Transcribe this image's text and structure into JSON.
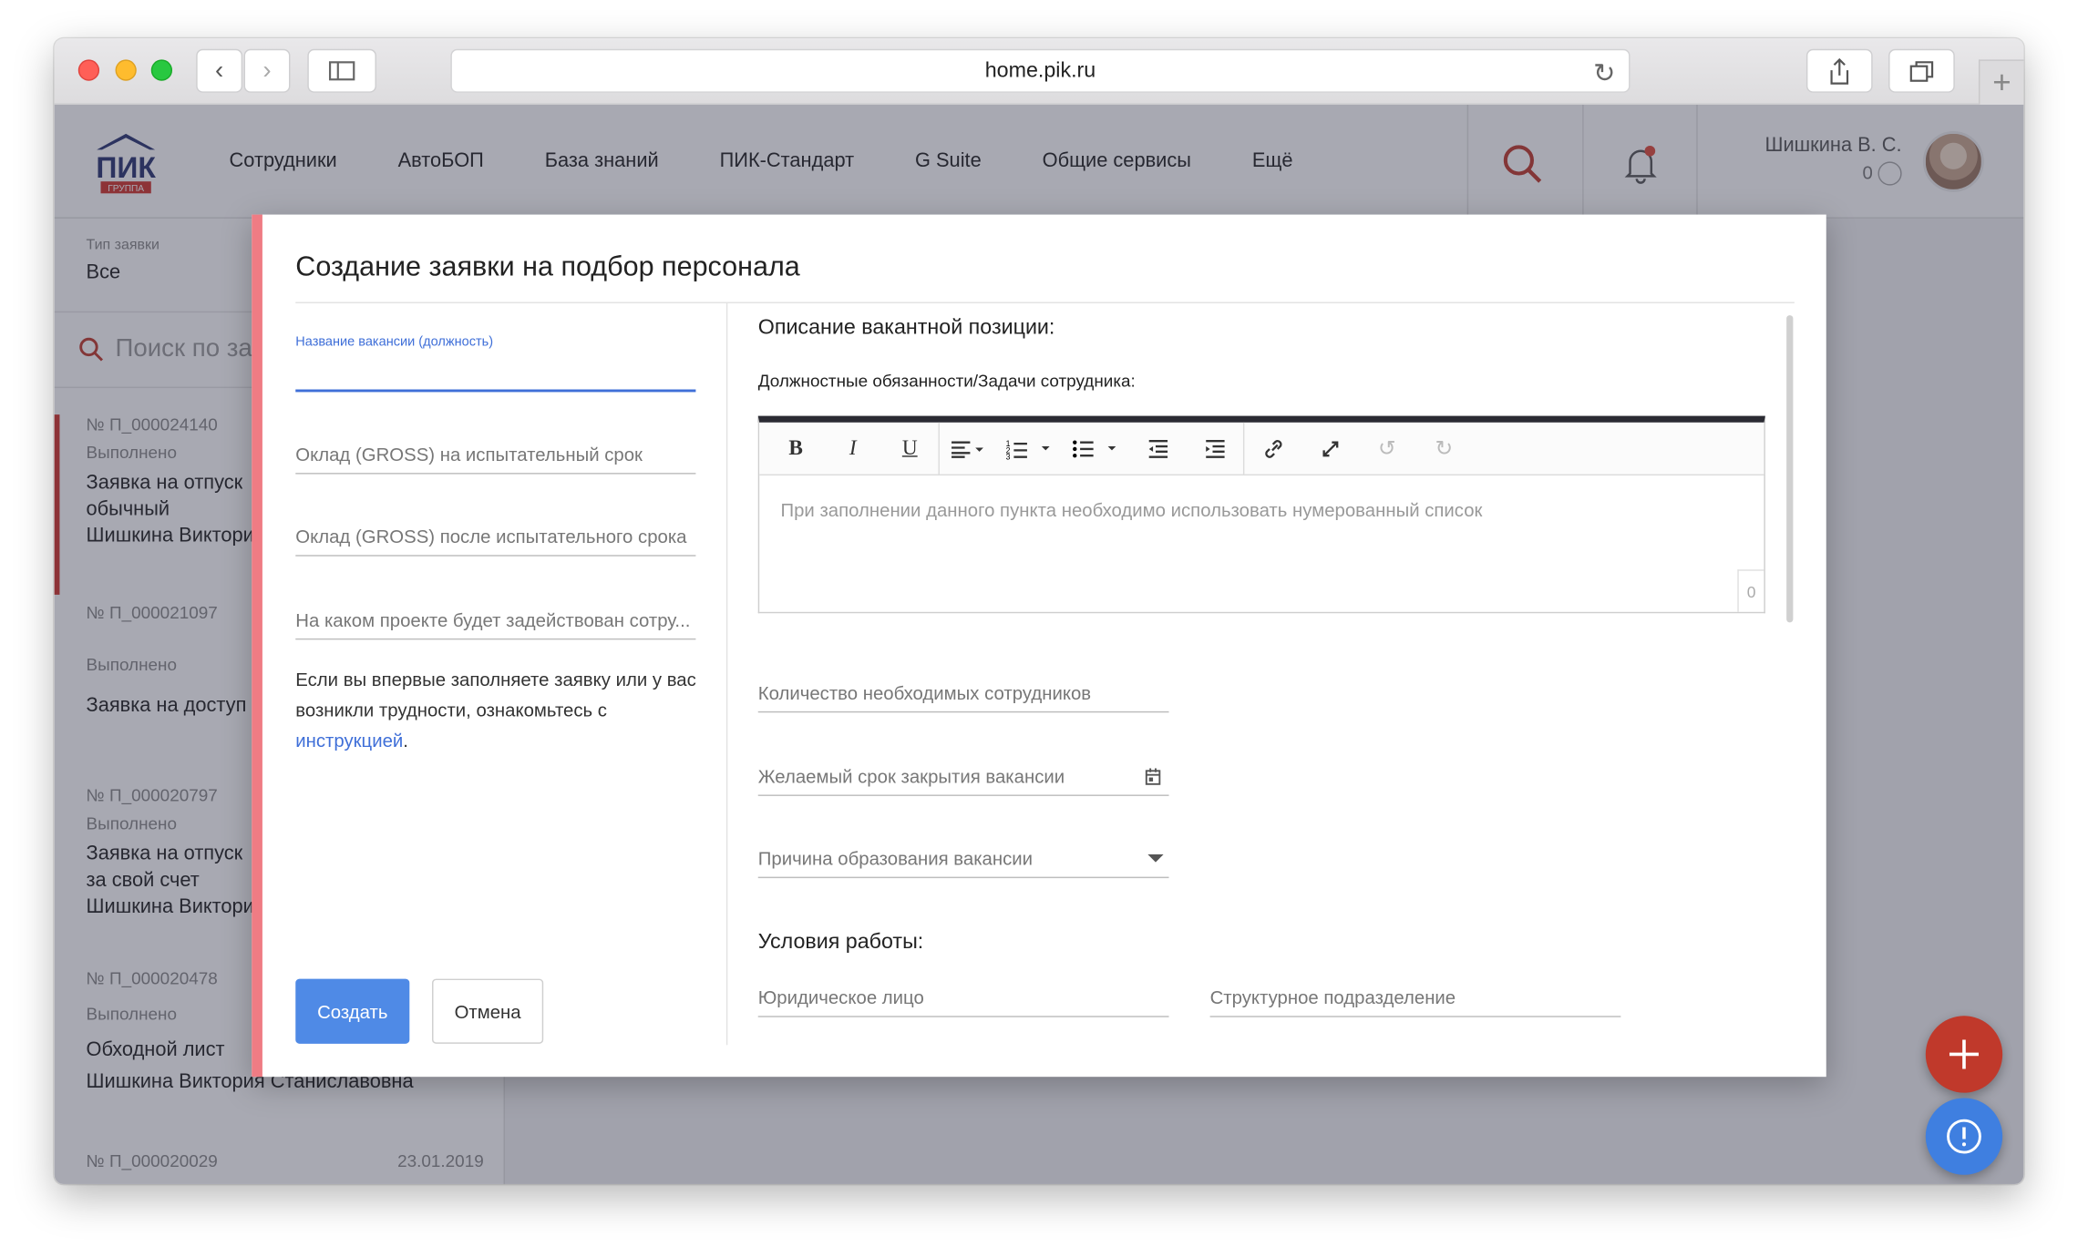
{
  "browser": {
    "url": "home.pik.ru",
    "new_tab_label": "+"
  },
  "header": {
    "logo_text": "ПИК",
    "logo_sub": "ГРУППА",
    "nav": [
      "Сотрудники",
      "АвтоБОП",
      "База знаний",
      "ПИК-Стандарт",
      "G Suite",
      "Общие сервисы",
      "Ещё"
    ],
    "user_name": "Шишкина В. С.",
    "user_count": "0"
  },
  "list": {
    "filter_label": "Тип заявки",
    "filter_value": "Все",
    "search_placeholder": "Поиск по за",
    "items": [
      {
        "num": "№ П_000024140",
        "status": "Выполнено",
        "title_lines": [
          "Заявка на отпуск",
          "обычный",
          "Шишкина Виктори"
        ],
        "date": ""
      },
      {
        "num": "№ П_000021097",
        "status": "Выполнено",
        "title_lines": [
          "Заявка на доступ"
        ],
        "date": ""
      },
      {
        "num": "№ П_000020797",
        "status": "Выполнено",
        "title_lines": [
          "Заявка на отпуск",
          "за свой счет",
          "Шишкина Виктори"
        ],
        "date": ""
      },
      {
        "num": "№ П_000020478",
        "status": "Выполнено",
        "title_lines": [
          "Обходной лист",
          "Шишкина Виктория Станиславовна"
        ],
        "date": ""
      },
      {
        "num": "№ П_000020029",
        "status": "",
        "title_lines": [],
        "date": "23.01.2019"
      }
    ]
  },
  "modal": {
    "title": "Создание заявки на подбор персонала",
    "fields": {
      "vacancy_label": "Название вакансии (должность)",
      "salary_probation": "Оклад (GROSS) на испытательный срок",
      "salary_after": "Оклад (GROSS) после испытательного срока",
      "project": "На каком проекте будет задействован сотру..."
    },
    "help_text": "Если вы впервые заполняете заявку или у вас возникли трудности, ознакомьтесь с ",
    "help_link": "инструкцией",
    "help_end": ".",
    "create_label": "Создать",
    "cancel_label": "Отмена",
    "description_heading": "Описание вакантной позиции:",
    "duties_label": "Должностные обязанности/Задачи сотрудника:",
    "editor": {
      "tools": [
        "bold-icon",
        "italic-icon",
        "underline-icon",
        "align-icon",
        "ordered-list-icon",
        "bullet-list-icon",
        "outdent-icon",
        "indent-icon",
        "link-icon",
        "fullscreen-icon",
        "undo-icon",
        "redo-icon"
      ],
      "placeholder": "При заполнении данного пункта необходимо использовать нумерованный список",
      "counter": "0"
    },
    "count_label": "Количество необходимых сотрудников",
    "deadline_label": "Желаемый срок закрытия вакансии",
    "reason_label": "Причина образования вакансии",
    "conditions_heading": "Условия работы:",
    "legal_entity_label": "Юридическое лицо",
    "department_label": "Структурное подразделение"
  },
  "colors": {
    "accent": "#4f8ae6",
    "brand": "#2a3470",
    "danger": "#c0392b",
    "modal_stripe": "#ef7c84"
  }
}
